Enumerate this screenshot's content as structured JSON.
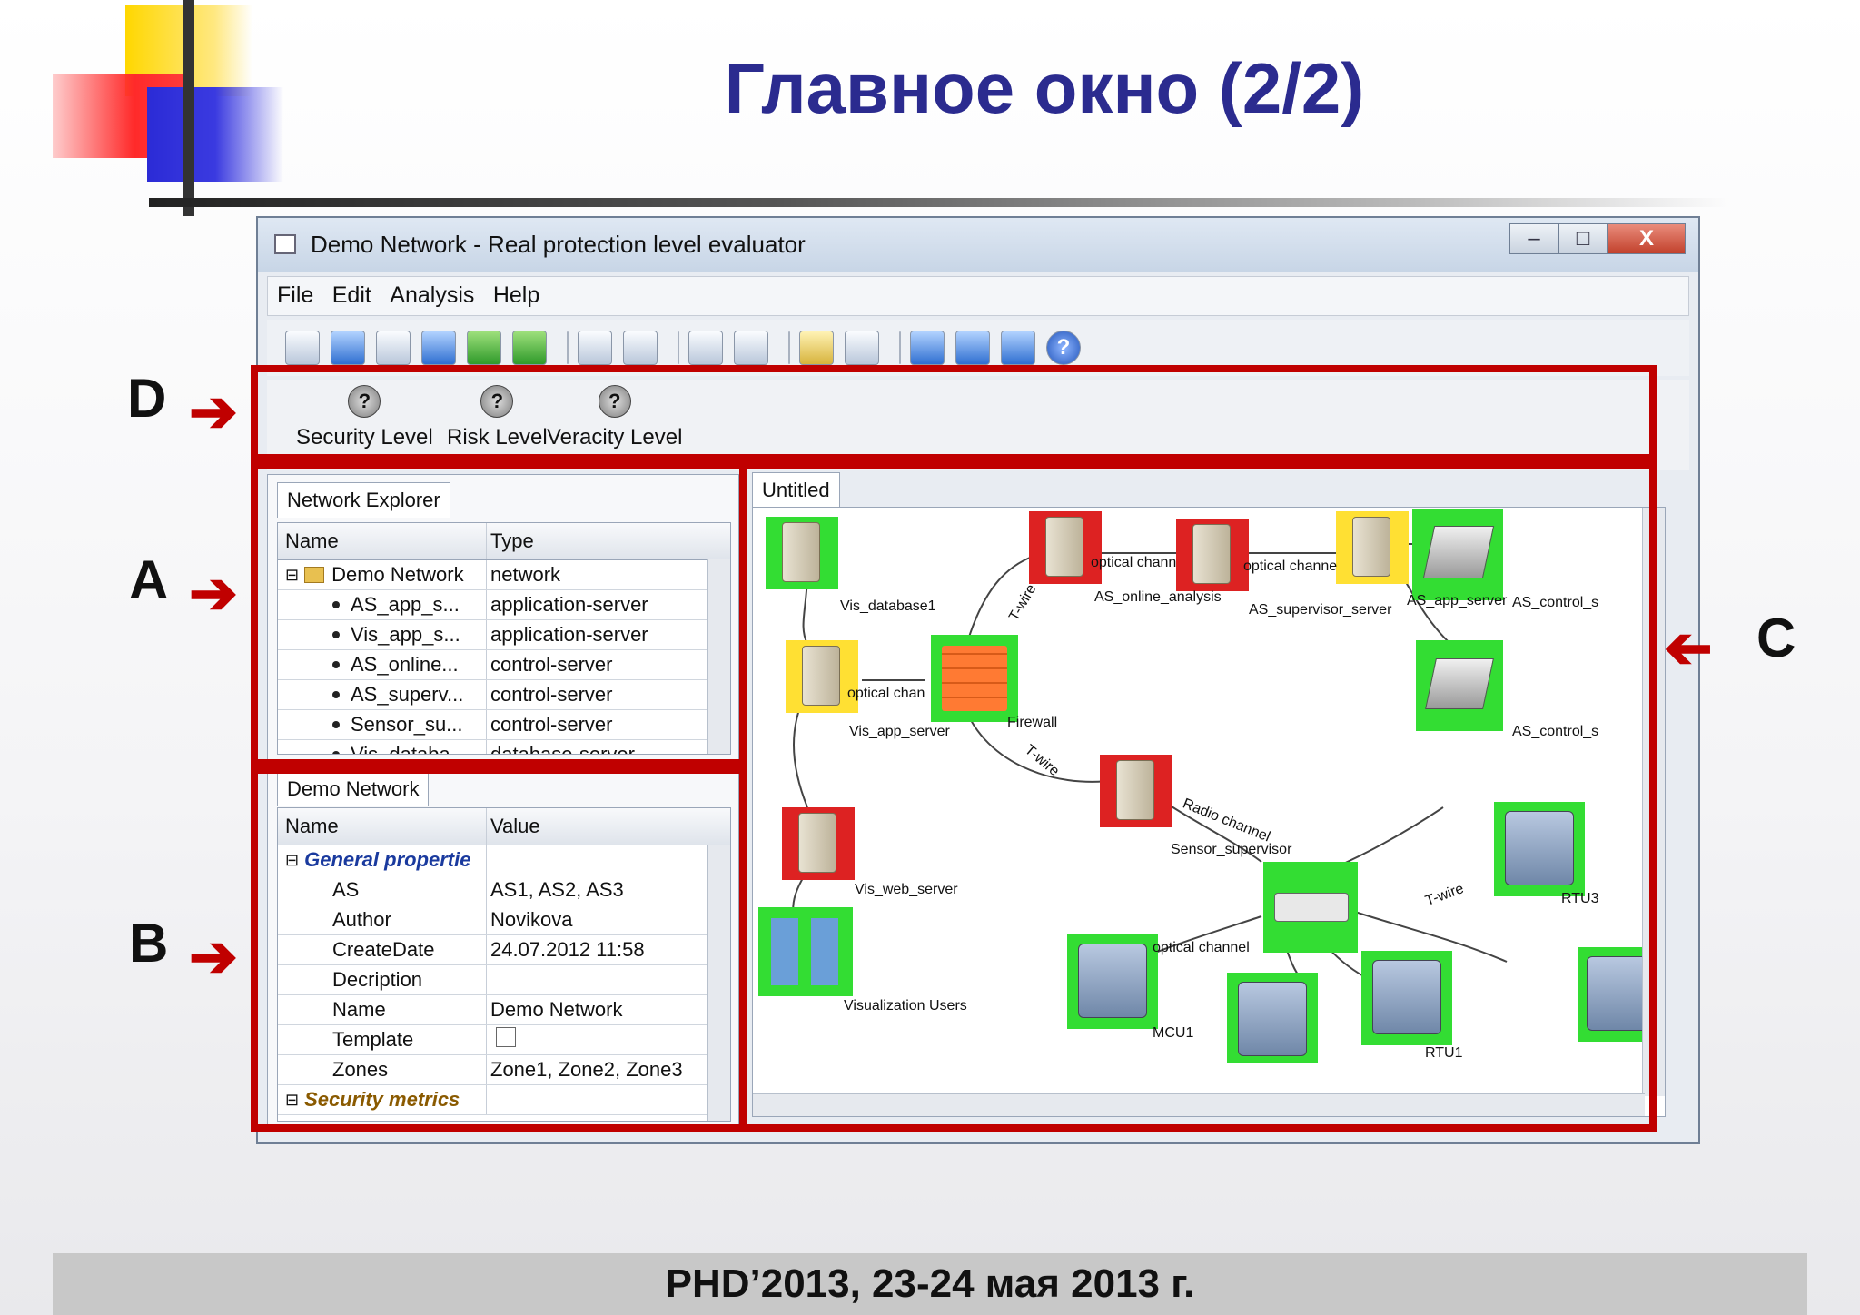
{
  "slide": {
    "title": "Главное окно (2/2)",
    "footer": "PHD’2013, 23-24 мая 2013 г."
  },
  "window": {
    "title": "Demo Network - Real protection level evaluator",
    "btn_min": "–",
    "btn_max": "□",
    "btn_close": "X"
  },
  "menu": [
    "File",
    "Edit",
    "Analysis",
    "Help"
  ],
  "toolbar_help": "?",
  "levels": [
    {
      "glyph": "?",
      "label": "Security Level"
    },
    {
      "glyph": "?",
      "label": "Risk Level"
    },
    {
      "glyph": "?",
      "label": "Veracity Level"
    }
  ],
  "explorer": {
    "tab": "Network Explorer",
    "col_name": "Name",
    "col_type": "Type",
    "root": {
      "name": "Demo Network",
      "type": "network"
    },
    "rows": [
      {
        "name": "AS_app_s...",
        "type": "application-server"
      },
      {
        "name": "Vis_app_s...",
        "type": "application-server"
      },
      {
        "name": "AS_online...",
        "type": "control-server"
      },
      {
        "name": "AS_superv...",
        "type": "control-server"
      },
      {
        "name": "Sensor_su...",
        "type": "control-server"
      },
      {
        "name": "Vis_databa...",
        "type": "database-server"
      }
    ]
  },
  "properties": {
    "tab": "Demo Network",
    "col_name": "Name",
    "col_value": "Value",
    "group1": "General propertie",
    "rows": [
      {
        "name": "AS",
        "value": "AS1, AS2, AS3"
      },
      {
        "name": "Author",
        "value": "Novikova"
      },
      {
        "name": "CreateDate",
        "value": "24.07.2012 11:58"
      },
      {
        "name": "Decription",
        "value": ""
      },
      {
        "name": "Name",
        "value": "Demo Network"
      },
      {
        "name": "Template",
        "value": ""
      },
      {
        "name": "Zones",
        "value": "Zone1, Zone2, Zone3"
      }
    ],
    "group2": "Security metrics"
  },
  "canvas": {
    "tab": "Untitled",
    "labels": {
      "vis_db": "Vis_database1",
      "vis_app": "Vis_app_server",
      "vis_web": "Vis_web_server",
      "vis_users": "Visualization Users",
      "firewall": "Firewall",
      "as_online": "AS_online_analysis",
      "as_superv": "AS_supervisor_server",
      "as_app": "AS_app_server",
      "as_control1": "AS_control_s",
      "as_control2": "AS_control_s",
      "sensor": "Sensor_supervisor",
      "mcu1": "MCU1",
      "rtu1": "RTU1",
      "rtu3": "RTU3",
      "optical1": "optical chann",
      "optical2": "optical channe",
      "optical3": "optical chan",
      "optical4": "optical channel",
      "twire1": "T-wire",
      "twire2": "T-wire",
      "twire3": "T-wire",
      "radio": "Radio channel"
    }
  },
  "annotations": {
    "a": "A",
    "b": "B",
    "c": "C",
    "d": "D"
  }
}
